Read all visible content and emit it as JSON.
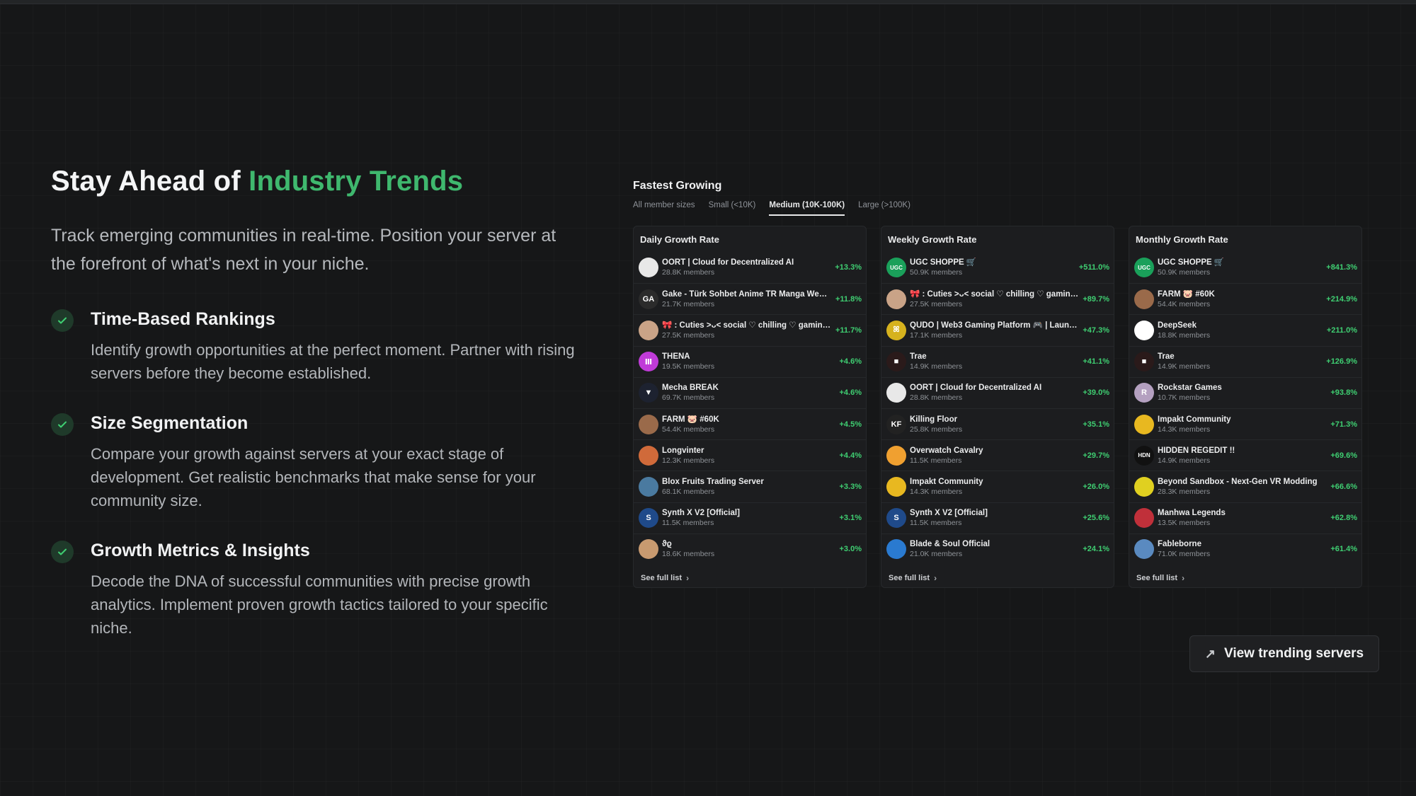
{
  "hero": {
    "headline_prefix": "Stay Ahead of ",
    "headline_accent": "Industry Trends",
    "lead": "Track emerging communities in real-time. Position your server at the forefront of what's next in your niche."
  },
  "features": [
    {
      "title": "Time-Based Rankings",
      "desc": "Identify growth opportunities at the perfect moment. Partner with rising servers before they become established.",
      "icon": "check-icon"
    },
    {
      "title": "Size Segmentation",
      "desc": "Compare your growth against servers at your exact stage of development. Get realistic benchmarks that make sense for your community size.",
      "icon": "check-icon"
    },
    {
      "title": "Growth Metrics & Insights",
      "desc": "Decode the DNA of successful communities with precise growth analytics. Implement proven growth tactics tailored to your specific niche.",
      "icon": "check-icon"
    }
  ],
  "panel": {
    "title": "Fastest Growing",
    "tabs": [
      "All member sizes",
      "Small (<10K)",
      "Medium (10K-100K)",
      "Large (>100K)"
    ],
    "active_tab": "Medium (10K-100K)",
    "see_full": "See full list",
    "accent_color": "#3fcf72"
  },
  "daily": {
    "title": "Daily Growth Rate",
    "rows": [
      {
        "name": "OORT | Cloud for Decentralized AI",
        "members": "28.8K members",
        "pct": "+13.3%",
        "avatar": "",
        "color": "#e8e8e8"
      },
      {
        "name": "Gake - Türk Sohbet Anime TR Manga Webt...",
        "members": "21.7K members",
        "pct": "+11.8%",
        "avatar": "GA",
        "color": "#2b2b2b"
      },
      {
        "name": "🎀 : Cuties >ᴗ< social ♡ chilling ♡ gaming...",
        "members": "27.5K members",
        "pct": "+11.7%",
        "avatar": "",
        "color": "#c9a387"
      },
      {
        "name": "THENA",
        "members": "19.5K members",
        "pct": "+4.6%",
        "avatar": "Ⅲ",
        "color": "#c03bd8"
      },
      {
        "name": "Mecha BREAK",
        "members": "69.7K members",
        "pct": "+4.6%",
        "avatar": "▼",
        "color": "#1d2230"
      },
      {
        "name": "FARM 🐷 #60K",
        "members": "54.4K members",
        "pct": "+4.5%",
        "avatar": "",
        "color": "#9a6a4a"
      },
      {
        "name": "Longvinter",
        "members": "12.3K members",
        "pct": "+4.4%",
        "avatar": "",
        "color": "#d06a3a"
      },
      {
        "name": "Blox Fruits Trading Server",
        "members": "68.1K members",
        "pct": "+3.3%",
        "avatar": "",
        "color": "#4a7aa0"
      },
      {
        "name": "Synth X V2 [Official]",
        "members": "11.5K members",
        "pct": "+3.1%",
        "avatar": "S",
        "color": "#1f4a8a"
      },
      {
        "name": "ϑϱ",
        "members": "18.6K members",
        "pct": "+3.0%",
        "avatar": "",
        "color": "#c89a70"
      }
    ]
  },
  "weekly": {
    "title": "Weekly Growth Rate",
    "rows": [
      {
        "name": "UGC SHOPPE 🛒",
        "members": "50.9K members",
        "pct": "+511.0%",
        "avatar": "UGC",
        "color": "#1aa05a"
      },
      {
        "name": "🎀 : Cuties >ᴗ< social ♡ chilling ♡ gaming...",
        "members": "27.5K members",
        "pct": "+89.7%",
        "avatar": "",
        "color": "#c9a387"
      },
      {
        "name": "QUDO | Web3 Gaming Platform 🎮 | Launc...",
        "members": "17.1K members",
        "pct": "+47.3%",
        "avatar": "ꕤ",
        "color": "#d6b21e"
      },
      {
        "name": "Trae",
        "members": "14.9K members",
        "pct": "+41.1%",
        "avatar": "■",
        "color": "#2a1a1a"
      },
      {
        "name": "OORT | Cloud for Decentralized AI",
        "members": "28.8K members",
        "pct": "+39.0%",
        "avatar": "",
        "color": "#e8e8e8"
      },
      {
        "name": "Killing Floor",
        "members": "25.8K members",
        "pct": "+35.1%",
        "avatar": "KF",
        "color": "#222"
      },
      {
        "name": "Overwatch Cavalry",
        "members": "11.5K members",
        "pct": "+29.7%",
        "avatar": "",
        "color": "#f0a030"
      },
      {
        "name": "Impakt Community",
        "members": "14.3K members",
        "pct": "+26.0%",
        "avatar": "",
        "color": "#e8b820"
      },
      {
        "name": "Synth X V2 [Official]",
        "members": "11.5K members",
        "pct": "+25.6%",
        "avatar": "S",
        "color": "#1f4a8a"
      },
      {
        "name": "Blade & Soul Official",
        "members": "21.0K members",
        "pct": "+24.1%",
        "avatar": "",
        "color": "#2a7ad0"
      }
    ]
  },
  "monthly": {
    "title": "Monthly Growth Rate",
    "rows": [
      {
        "name": "UGC SHOPPE 🛒",
        "members": "50.9K members",
        "pct": "+841.3%",
        "avatar": "UGC",
        "color": "#1aa05a"
      },
      {
        "name": "FARM 🐷 #60K",
        "members": "54.4K members",
        "pct": "+214.9%",
        "avatar": "",
        "color": "#9a6a4a"
      },
      {
        "name": "DeepSeek",
        "members": "18.8K members",
        "pct": "+211.0%",
        "avatar": "",
        "color": "#ffffff"
      },
      {
        "name": "Trae",
        "members": "14.9K members",
        "pct": "+126.9%",
        "avatar": "■",
        "color": "#2a1a1a"
      },
      {
        "name": "Rockstar Games",
        "members": "10.7K members",
        "pct": "+93.8%",
        "avatar": "R",
        "color": "#b4a0c0"
      },
      {
        "name": "Impakt Community",
        "members": "14.3K members",
        "pct": "+71.3%",
        "avatar": "",
        "color": "#e8b820"
      },
      {
        "name": "HIDDEN REGEDIT !!",
        "members": "14.9K members",
        "pct": "+69.6%",
        "avatar": "HDN",
        "color": "#111"
      },
      {
        "name": "Beyond Sandbox - Next-Gen VR Modding",
        "members": "28.3K members",
        "pct": "+66.6%",
        "avatar": "",
        "color": "#e0d020"
      },
      {
        "name": "Manhwa Legends",
        "members": "13.5K members",
        "pct": "+62.8%",
        "avatar": "",
        "color": "#c0303a"
      },
      {
        "name": "Fableborne",
        "members": "71.0K members",
        "pct": "+61.4%",
        "avatar": "",
        "color": "#5a8ac0"
      }
    ]
  },
  "cta": {
    "label": "View trending servers",
    "icon": "arrow-up-right-icon"
  }
}
